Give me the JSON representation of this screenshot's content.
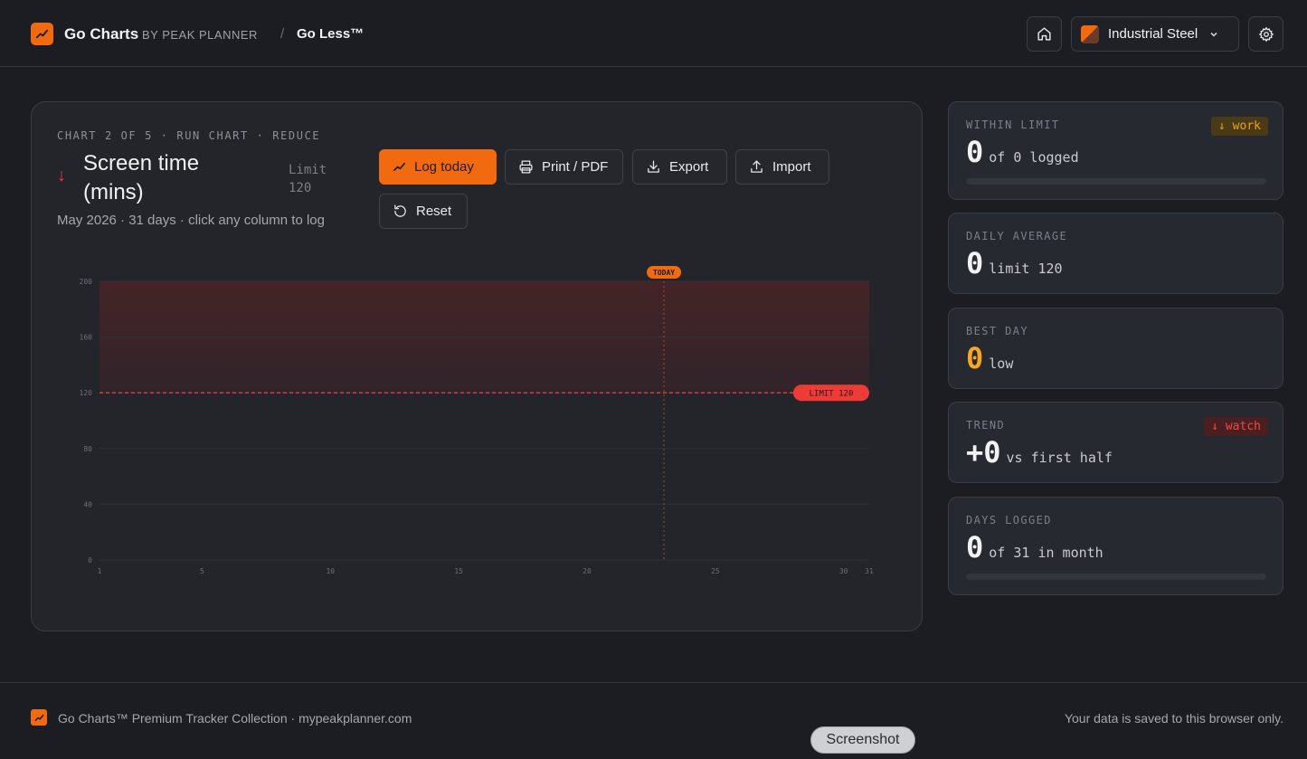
{
  "header": {
    "brand_name": "Go Charts",
    "brand_by": "BY PEAK PLANNER",
    "separator": "/",
    "breadcrumb": "Go Less™",
    "theme_name": "Industrial Steel"
  },
  "card": {
    "eyebrow": "CHART 2 OF 5 · RUN CHART · REDUCE",
    "title": "Screen time (mins)",
    "limit_label": "Limit 120",
    "subtitle": "May 2026 · 31 days · click any column to log",
    "buttons": {
      "log": "Log today",
      "print": "Print / PDF",
      "export": "Export",
      "import": "Import",
      "reset": "Reset"
    }
  },
  "chart_data": {
    "type": "bar",
    "x_ticks": [
      1,
      5,
      10,
      15,
      20,
      25,
      30,
      31
    ],
    "y_ticks": [
      0,
      40,
      80,
      120,
      160,
      200
    ],
    "xlim": [
      1,
      31
    ],
    "ylim": [
      0,
      200
    ],
    "values": [],
    "limit": 120,
    "limit_label": "LIMIT 120",
    "today": 23,
    "today_label": "TODAY",
    "colors": {
      "limit": "#ef3b36",
      "today": "#f26a10",
      "over_zone": "#4a2326"
    }
  },
  "stats": [
    {
      "label": "WITHIN LIMIT",
      "value": "0",
      "detail": "of 0 logged",
      "badge": "↓ work",
      "progress": 0
    },
    {
      "label": "DAILY AVERAGE",
      "value": "0",
      "detail": "limit 120"
    },
    {
      "label": "BEST DAY",
      "value": "0",
      "detail": "low"
    },
    {
      "label": "TREND",
      "value": "+0",
      "detail": "vs first half",
      "badge": "↓ watch"
    },
    {
      "label": "DAYS LOGGED",
      "value": "0",
      "detail": "of 31 in month",
      "progress": 0
    }
  ],
  "footer": {
    "left": "Go Charts™ Premium Tracker Collection · mypeakplanner.com",
    "right": "Your data is saved to this browser only."
  },
  "tooltip": "Screenshot",
  "colors": {
    "accent": "#f26a10",
    "danger": "#ef3b36",
    "warn_badge": "#e8a21c",
    "best_value": "#f5a623"
  }
}
